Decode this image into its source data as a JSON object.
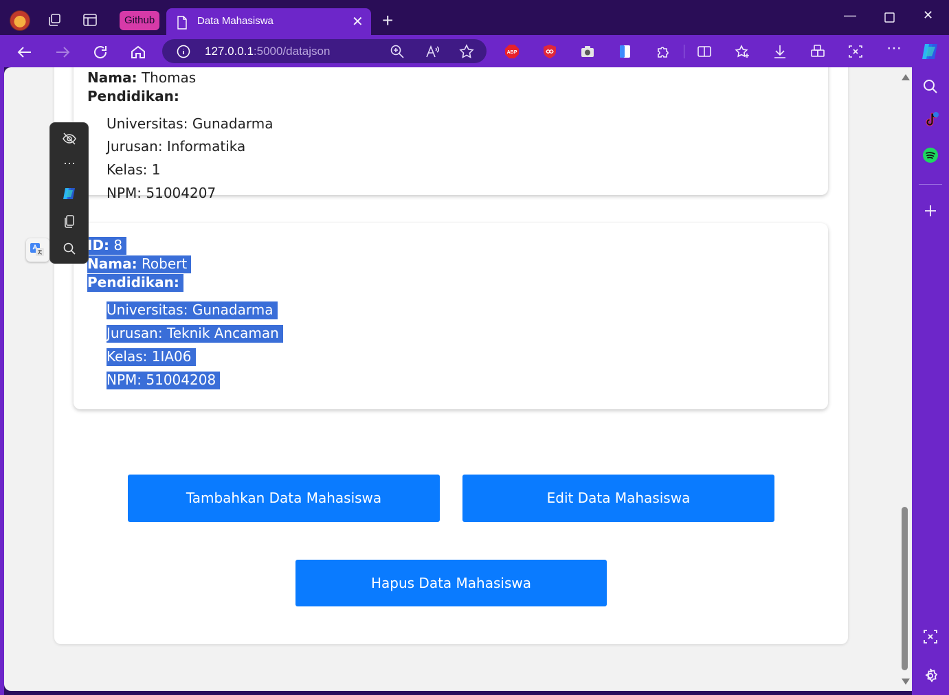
{
  "browser": {
    "tab_group_label": "Github",
    "active_tab_title": "Data Mahasiswa",
    "url_host": "127.0.0.1",
    "url_path": ":5000/datajson",
    "extensions": [
      "adblock-plus-icon",
      "infinity-icon",
      "camera-icon",
      "file-icon",
      "puzzle-icon"
    ],
    "accent_color": "#6d26c9",
    "titlebar_color": "#2a0d57",
    "abp_label": "ABP"
  },
  "records": [
    {
      "nama_label": "Nama:",
      "nama": "Thomas",
      "pendidikan_label": "Pendidikan:",
      "universitas": "Universitas: Gunadarma",
      "jurusan": "Jurusan: Informatika",
      "kelas": "Kelas: 1",
      "npm": "NPM: 51004207"
    },
    {
      "id_label": "ID:",
      "id": "8",
      "nama_label": "Nama:",
      "nama": "Robert",
      "pendidikan_label": "Pendidikan:",
      "universitas": "Universitas: Gunadarma",
      "jurusan": "Jurusan: Teknik Ancaman",
      "kelas": "Kelas: 1IA06",
      "npm": "NPM: 51004208"
    }
  ],
  "actions": {
    "add_label": "Tambahkan Data Mahasiswa",
    "edit_label": "Edit Data Mahasiswa",
    "delete_label": "Hapus Data Mahasiswa",
    "button_color": "#0a7bff"
  },
  "selection_highlight_color": "#3a6ed8"
}
